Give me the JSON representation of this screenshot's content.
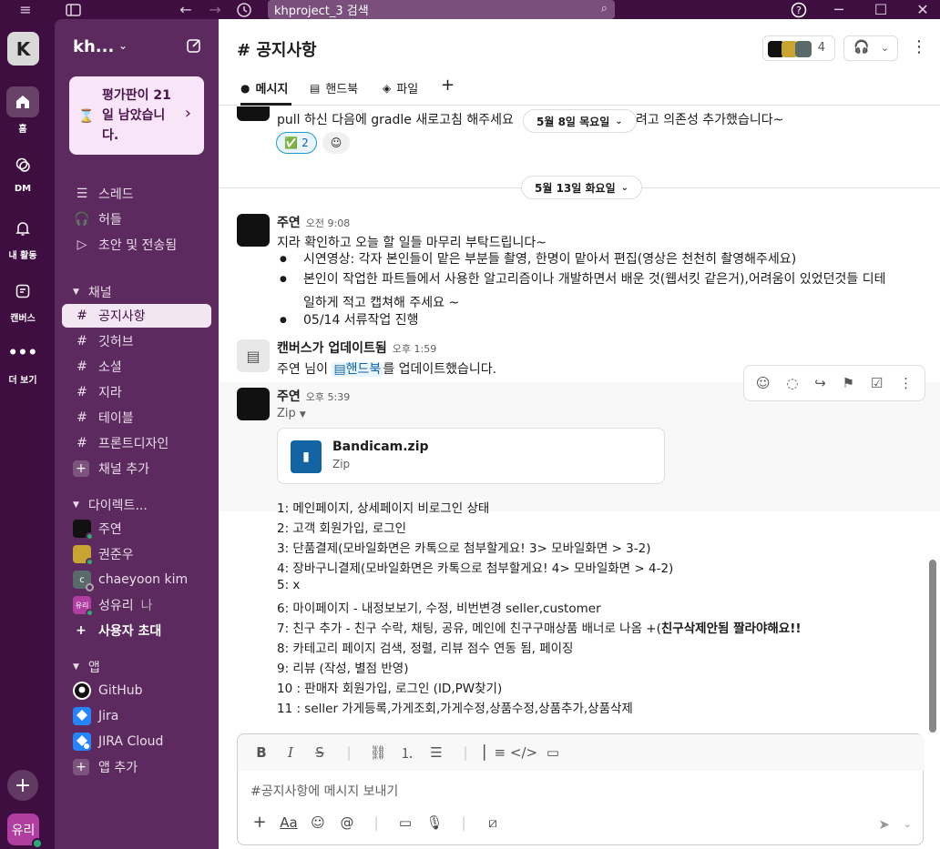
{
  "window": {
    "search_text": "khproject_3 검색"
  },
  "rail": {
    "workspace_initial": "K",
    "items": [
      {
        "label": "홈",
        "icon": "home-icon"
      },
      {
        "label": "DM",
        "icon": "dm-icon"
      },
      {
        "label": "내 활동",
        "icon": "bell-icon"
      },
      {
        "label": "캔버스",
        "icon": "canvas-icon"
      },
      {
        "label": "더 보기",
        "icon": "more-icon"
      }
    ],
    "me_label": "유리"
  },
  "sidebar": {
    "workspace_name": "kh...",
    "trial_text": "평가판이 21일 남았습니다.",
    "top_items": [
      {
        "label": "스레드",
        "icon": "threads-icon"
      },
      {
        "label": "허들",
        "icon": "headphones-icon"
      },
      {
        "label": "초안 및 전송됨",
        "icon": "send-icon"
      }
    ],
    "channels_header": "채널",
    "channels": [
      "공지사항",
      "깃허브",
      "소셜",
      "지라",
      "테이블",
      "프론트디자인"
    ],
    "add_channel": "채널 추가",
    "dm_header": "다이렉트...",
    "dms": [
      {
        "name": "주연",
        "color": "#111111"
      },
      {
        "name": "권준우",
        "color": "#c8a431"
      },
      {
        "name": "chaeyoon kim",
        "color": "#5a6a6a"
      },
      {
        "name": "성유리",
        "suffix": "나",
        "color": "#b03ea1"
      }
    ],
    "invite": "사용자 초대",
    "apps_header": "앱",
    "apps": [
      {
        "name": "GitHub",
        "color": "#ffffff"
      },
      {
        "name": "Jira",
        "color": "#2684ff"
      },
      {
        "name": "JIRA Cloud",
        "color": "#2684ff"
      }
    ],
    "add_app": "앱 추가"
  },
  "channel": {
    "name": "공지사항",
    "member_count": "4",
    "tabs": [
      "메시지",
      "핸드북",
      "파일"
    ]
  },
  "messages": {
    "partial_text": "pull 하신 다음에 gradle 새로고침 해주세요",
    "partial_tail": "려고 의존성 추가했습니다~",
    "reaction_emoji": "✅",
    "reaction_count": "2",
    "date_pill_1": "5월 8일 목요일",
    "date_pill_2": "5월 13일 화요일",
    "msg1": {
      "author": "주연",
      "time": "오전 9:08",
      "text": "지라 확인하고 오늘 할 일들 마무리 부탁드립니다~",
      "bullets": [
        "시연영상: 각자 본인들이 맡은 부분들 촬영, 한명이 맡아서 편집(영상은 천천히 촬영해주세요)",
        "본인이 작업한 파트들에서 사용한 알고리즘이나 개발하면서 배운 것(웹서킷 같은거),어려움이 있었던것들 디테",
        "일하게 적고 캡쳐해 주세요 ~",
        "05/14 서류작업 진행"
      ]
    },
    "canvas_msg": {
      "author": "캔버스가 업데이트됨",
      "time": "오후 1:59",
      "prefix": "주연 님이",
      "link": "핸드북",
      "suffix": "를 업데이트했습니다."
    },
    "msg2": {
      "author": "주연",
      "time": "오후 5:39",
      "file_label": "Zip",
      "file_name": "Bandicam.zip",
      "file_type": "Zip",
      "lines": [
        "1: 메인페이지, 상세페이지 비로그인 상태",
        "2: 고객 회원가입, 로그인",
        "3: 단품결제(모바일화면은 카톡으로 첨부할게요! 3> 모바일화면 > 3-2)",
        "4: 장바구니결제(모바일화면은 카톡으로 첨부할게요! 4> 모바일화면 > 4-2)",
        "5: x",
        "6: 마이페이지 - 내정보보기, 수정, 비번변경 seller,customer",
        "7: 친구 추가 - 친구 수락, 채팅, 공유, 메인에 친구구매상품 배너로 나옴 +(",
        "8: 카테고리 페이지 검색, 정렬, 리뷰 점수 연동 됨, 페이징",
        "9: 리뷰 (작성, 별점 반영)",
        "10 : 판매자 회원가입, 로그인 (ID,PW찾기)",
        "11 : seller 가게등록,가게조회,가게수정,상품수정,상품추가,상품삭제"
      ],
      "line7_bold": "친구삭제안됨 짤라야해요!!"
    }
  },
  "composer": {
    "placeholder": "#공지사항에 메시지 보내기"
  }
}
